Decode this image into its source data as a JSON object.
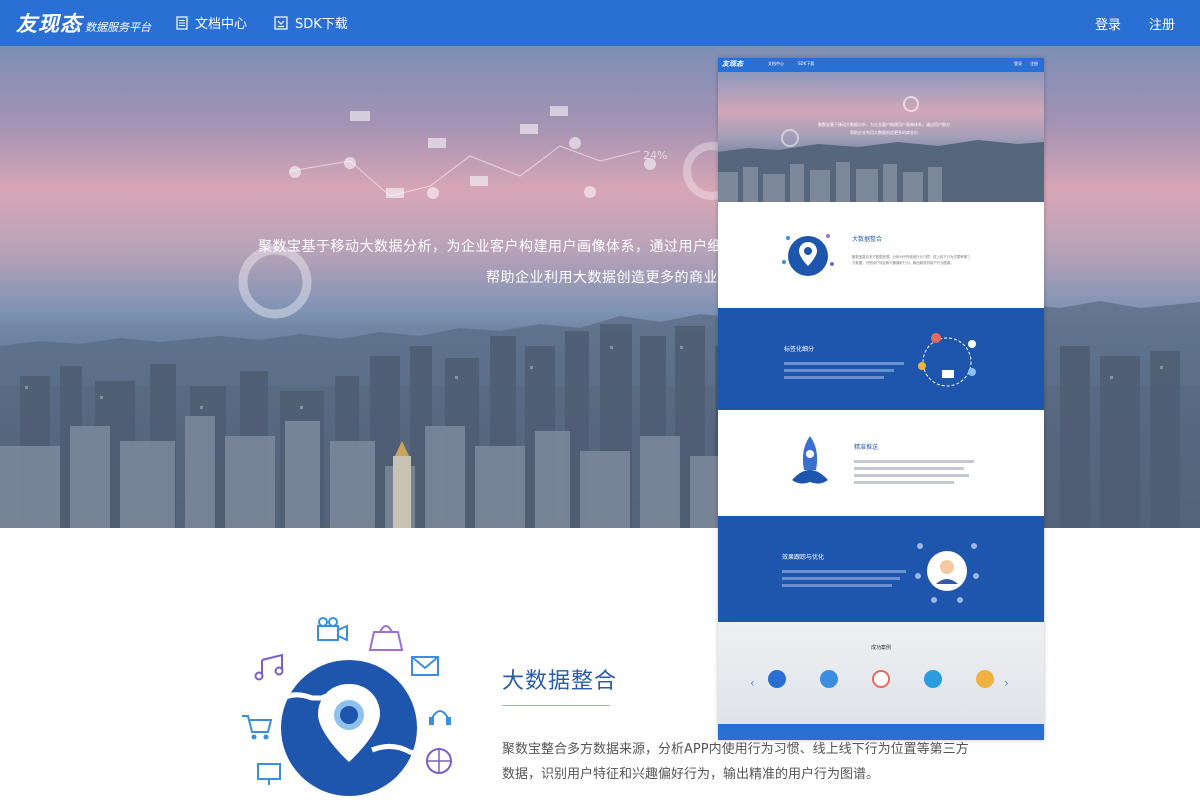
{
  "nav": {
    "logo": "友现态",
    "logo_sub": "数据服务平台",
    "items": [
      {
        "label": "文档中心",
        "icon": "document-icon"
      },
      {
        "label": "SDK下载",
        "icon": "download-icon"
      }
    ],
    "login": "登录",
    "register": "注册"
  },
  "hero": {
    "line1": "聚数宝基于移动大数据分析，为企业客户构建用户画像体系，通过用户细分",
    "line2": "帮助企业利用大数据创造更多的商业价",
    "decor_percent": "24%"
  },
  "feature": {
    "title": "大数据整合",
    "description": "聚数宝整合多方数据来源，分析APP内使用行为习惯、线上线下行为位置等第三方数据，识别用户特征和兴趣偏好行为，输出精准的用户行为图谱。"
  },
  "preview": {
    "sections": [
      {
        "title": "大数据整合",
        "bg": "white"
      },
      {
        "title": "标签化细分",
        "bg": "blue"
      },
      {
        "title": "精准推送",
        "bg": "white"
      },
      {
        "title": "效果跟踪与优化",
        "bg": "blue"
      }
    ],
    "cases_title": "成功案例",
    "case_logos": [
      "icon-a",
      "icon-b",
      "icon-m",
      "icon-c",
      "icon-d"
    ]
  },
  "colors": {
    "brand_blue": "#2a6fd4",
    "section_blue": "#1f56ad"
  }
}
